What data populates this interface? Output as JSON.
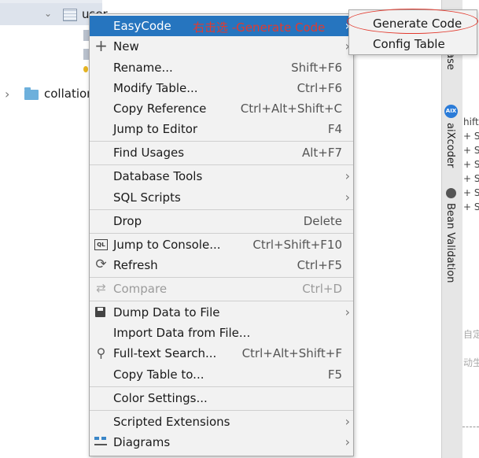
{
  "tree": {
    "user_label": "user",
    "collation_label": "collation"
  },
  "side_panel": {
    "database_label": "abase",
    "aixcoder_badge": "AIX",
    "aixcoder_label": "aiXcoder",
    "bean_label": "Bean Validation"
  },
  "right_pane": {
    "shift_fragment": "hift",
    "plus_fragments": [
      "+ S",
      "+ S",
      "+ S",
      "+ S",
      "+ S",
      "+ S"
    ],
    "fragment_1": "自定",
    "fragment_2": "动生"
  },
  "annotation": "右击选 -Generate Code",
  "context_menu": {
    "items": [
      {
        "label": "EasyCode",
        "shortcut": "",
        "submenu": true
      },
      {
        "label": "New",
        "shortcut": "",
        "submenu": true,
        "icon": "plus-icon"
      },
      {
        "label": "Rename...",
        "shortcut": "Shift+F6"
      },
      {
        "label": "Modify Table...",
        "shortcut": "Ctrl+F6"
      },
      {
        "label": "Copy Reference",
        "shortcut": "Ctrl+Alt+Shift+C"
      },
      {
        "label": "Jump to Editor",
        "shortcut": "F4"
      },
      {
        "label": "Find Usages",
        "shortcut": "Alt+F7"
      },
      {
        "label": "Database Tools",
        "shortcut": "",
        "submenu": true
      },
      {
        "label": "SQL Scripts",
        "shortcut": "",
        "submenu": true
      },
      {
        "label": "Drop",
        "shortcut": "Delete"
      },
      {
        "label": "Jump to Console...",
        "shortcut": "Ctrl+Shift+F10",
        "icon": "console-icon",
        "icon_text": "QL"
      },
      {
        "label": "Refresh",
        "shortcut": "Ctrl+F5",
        "icon": "refresh-icon"
      },
      {
        "label": "Compare",
        "shortcut": "Ctrl+D",
        "icon": "compare-icon",
        "disabled": true
      },
      {
        "label": "Dump Data to File",
        "shortcut": "",
        "submenu": true,
        "icon": "save-icon"
      },
      {
        "label": "Import Data from File...",
        "shortcut": ""
      },
      {
        "label": "Full-text Search...",
        "shortcut": "Ctrl+Alt+Shift+F",
        "icon": "search-icon"
      },
      {
        "label": "Copy Table to...",
        "shortcut": "F5"
      },
      {
        "label": "Color Settings...",
        "shortcut": ""
      },
      {
        "label": "Scripted Extensions",
        "shortcut": "",
        "submenu": true
      },
      {
        "label": "Diagrams",
        "shortcut": "",
        "submenu": true,
        "icon": "diagram-icon"
      }
    ]
  },
  "submenu": {
    "items": [
      {
        "label": "Generate Code"
      },
      {
        "label": "Config Table"
      }
    ]
  },
  "colors": {
    "highlight": "#2675bf",
    "annotation_red": "#e23a2e",
    "menu_background": "#f2f2f2"
  }
}
